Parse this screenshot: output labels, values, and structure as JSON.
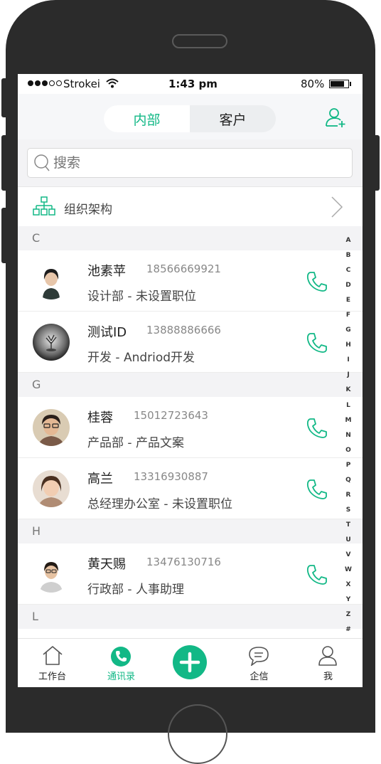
{
  "status_bar": {
    "carrier": "Strokei",
    "time": "1:43 pm",
    "battery": "80%",
    "battery_level": 0.8
  },
  "header": {
    "segments": [
      {
        "label": "内部",
        "active": true
      },
      {
        "label": "客户",
        "active": false
      }
    ],
    "add_icon": "add-user-icon"
  },
  "search": {
    "placeholder": "搜索"
  },
  "org": {
    "label": "组织架构"
  },
  "sections": [
    {
      "letter": "C",
      "contacts": [
        {
          "name": "池素苹",
          "phone": "18566669921",
          "dept": "设计部 - 未设置职位"
        },
        {
          "name": "测试ID",
          "phone": "13888886666",
          "dept": "开发 - Andriod开发"
        }
      ]
    },
    {
      "letter": "G",
      "contacts": [
        {
          "name": "桂蓉",
          "phone": "15012723643",
          "dept": "产品部 - 产品文案"
        },
        {
          "name": "高兰",
          "phone": "13316930887",
          "dept": "总经理办公室 - 未设置职位"
        }
      ]
    },
    {
      "letter": "H",
      "contacts": [
        {
          "name": "黄天赐",
          "phone": "13476130716",
          "dept": "行政部 - 人事助理"
        }
      ]
    },
    {
      "letter": "L",
      "contacts": []
    }
  ],
  "index_letters": [
    "A",
    "B",
    "C",
    "D",
    "E",
    "F",
    "G",
    "H",
    "I",
    "J",
    "K",
    "L",
    "M",
    "N",
    "O",
    "P",
    "Q",
    "R",
    "S",
    "T",
    "U",
    "V",
    "W",
    "X",
    "Y",
    "Z",
    "#"
  ],
  "tabs": [
    {
      "label": "工作台",
      "icon": "house-icon"
    },
    {
      "label": "通讯录",
      "icon": "phone-icon",
      "active": true
    },
    {
      "label": "",
      "icon": "plus-icon"
    },
    {
      "label": "企信",
      "icon": "chat-icon"
    },
    {
      "label": "我",
      "icon": "person-icon"
    }
  ],
  "colors": {
    "accent": "#12b886",
    "phone_body": "#2b2b2b",
    "background": "#f3f3f5"
  }
}
